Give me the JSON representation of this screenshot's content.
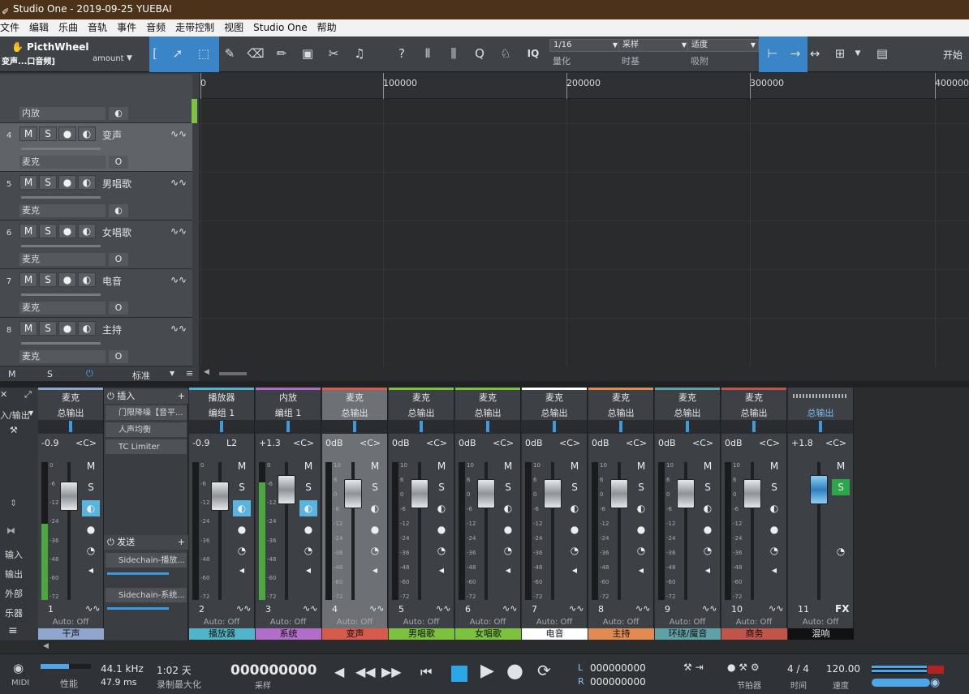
{
  "window": {
    "title": "Studio One - 2019-09-25 YUEBAI"
  },
  "menu": [
    "文件",
    "编辑",
    "乐曲",
    "音轨",
    "事件",
    "音频",
    "走带控制",
    "视图",
    "Studio One",
    "帮助"
  ],
  "toolbar": {
    "instrument_name": "PicthWheel",
    "track_label": "变声...口音频]",
    "param_label": "amount",
    "quantize_value": "1/16",
    "quantize_label": "量化",
    "timebase_value": "采样",
    "timebase_label": "时基",
    "snap_value": "适度",
    "snap_label": "吸附",
    "start_label": "开始",
    "iq": "IQ"
  },
  "ruler": {
    "ticks": [
      "0",
      "100000",
      "200000",
      "300000",
      "400000"
    ]
  },
  "tracks": [
    {
      "num": "",
      "name": "",
      "input": "内放",
      "monitor": "◐"
    },
    {
      "num": "4",
      "name": "变声",
      "input": "麦克",
      "monitor": "O",
      "selected": true
    },
    {
      "num": "5",
      "name": "男唱歌",
      "input": "麦克",
      "monitor": "◐"
    },
    {
      "num": "6",
      "name": "女唱歌",
      "input": "麦克",
      "monitor": "O"
    },
    {
      "num": "7",
      "name": "电音",
      "input": "麦克",
      "monitor": "O"
    },
    {
      "num": "8",
      "name": "主持",
      "input": "麦克",
      "monitor": "O"
    }
  ],
  "track_buttons": {
    "m": "M",
    "s": "S"
  },
  "track_footer": {
    "m": "M",
    "s": "S",
    "mode": "标准"
  },
  "console_left": {
    "io": "入/输出",
    "input": "输入",
    "output": "输出",
    "external": "外部",
    "instrument": "乐器"
  },
  "inserts": {
    "title": "插入",
    "items": [
      "门限降噪【音平...",
      "人声均衡",
      "TC Limiter"
    ],
    "sends_title": "发送",
    "sends": [
      "Sidechain-播放...",
      "Sidechain-系统..."
    ]
  },
  "channels": [
    {
      "in": "麦克",
      "out": "总输出",
      "vol": "-0.9",
      "pan": "<C>",
      "num": "1",
      "auto": "Auto: Off",
      "name": "干声",
      "color": "#8fa6cf",
      "fader": 0.82,
      "meter": 0.55
    },
    {
      "in": "播放器",
      "out": "编组 1",
      "vol": "-0.9",
      "pan": "L2",
      "num": "2",
      "auto": "Auto: Off",
      "name": "播放器",
      "color": "#4fb6c9",
      "fader": 0.82,
      "meter": 0
    },
    {
      "in": "内放",
      "out": "编组 1",
      "vol": "+1.3",
      "pan": "<C>",
      "num": "3",
      "auto": "Auto: Off",
      "name": "系统",
      "color": "#b06ec8",
      "fader": 0.88,
      "meter": 0.85
    },
    {
      "in": "麦克",
      "out": "总输出",
      "vol": "0dB",
      "pan": "<C>",
      "num": "4",
      "auto": "Auto: Off",
      "name": "变声",
      "color": "#d75a4a",
      "fader": 0.84,
      "meter": 0,
      "selected": true
    },
    {
      "in": "麦克",
      "out": "总输出",
      "vol": "0dB",
      "pan": "<C>",
      "num": "5",
      "auto": "Auto: Off",
      "name": "男唱歌",
      "color": "#7cc23c",
      "fader": 0.84,
      "meter": 0
    },
    {
      "in": "麦克",
      "out": "总输出",
      "vol": "0dB",
      "pan": "<C>",
      "num": "6",
      "auto": "Auto: Off",
      "name": "女唱歌",
      "color": "#7cc23c",
      "fader": 0.84,
      "meter": 0
    },
    {
      "in": "麦克",
      "out": "总输出",
      "vol": "0dB",
      "pan": "<C>",
      "num": "7",
      "auto": "Auto: Off",
      "name": "电音",
      "color": "#ffffff",
      "fader": 0.84,
      "meter": 0
    },
    {
      "in": "麦克",
      "out": "总输出",
      "vol": "0dB",
      "pan": "<C>",
      "num": "8",
      "auto": "Auto: Off",
      "name": "主持",
      "color": "#e18a52",
      "fader": 0.84,
      "meter": 0
    },
    {
      "in": "麦克",
      "out": "总输出",
      "vol": "0dB",
      "pan": "<C>",
      "num": "9",
      "auto": "Auto: Off",
      "name": "环绕/魔音",
      "color": "#5fa2a6",
      "fader": 0.84,
      "meter": 0
    },
    {
      "in": "麦克",
      "out": "总输出",
      "vol": "0dB",
      "pan": "<C>",
      "num": "10",
      "auto": "Auto: Off",
      "name": "商务",
      "color": "#c2554a",
      "fader": 0.84,
      "meter": 0
    }
  ],
  "fx_channel": {
    "out": "总输出",
    "vol": "+1.8",
    "pan": "<C>",
    "num": "11",
    "label": "FX",
    "auto": "Auto: Off",
    "name": "混响",
    "s": "S",
    "m": "M"
  },
  "meter_scale": [
    "0",
    "-6",
    "-12",
    "-24",
    "-36",
    "-48",
    "-60",
    "-72"
  ],
  "fader_scale": [
    "10",
    "6",
    "0",
    "-6",
    "-12",
    "-24",
    "-36",
    "-48",
    "-60",
    "-72"
  ],
  "transport": {
    "midi": "MIDI",
    "perf": "性能",
    "samplerate": "44.1 kHz",
    "latency": "47.9 ms",
    "record_days": "1:02 天",
    "record_label": "录制最大化",
    "position": "000000000",
    "position_unit": "采样",
    "l": "L",
    "r": "R",
    "l_val": "000000000",
    "r_val": "000000000",
    "metronome": "节拍器",
    "sig": "4 / 4",
    "sig_label": "时间",
    "tempo": "120.00",
    "tempo_label": "速度"
  }
}
